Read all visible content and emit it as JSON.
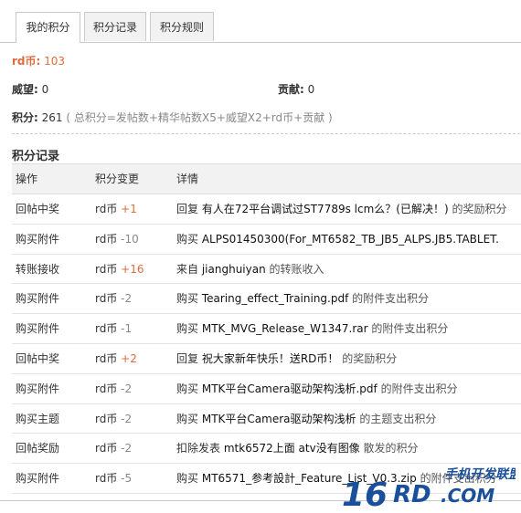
{
  "tabs": [
    "我的积分",
    "积分记录",
    "积分规则"
  ],
  "summary": {
    "rd_label": "rd币:",
    "rd_value": "103",
    "weiwang_label": "威望:",
    "weiwang_value": "0",
    "gongxian_label": "贡献:",
    "gongxian_value": "0",
    "total_label": "积分:",
    "total_value": "261",
    "total_formula": "( 总积分=发帖数+精华帖数X5+威望X2+rd币+贡献 )"
  },
  "section_title": "积分记录",
  "columns": [
    "操作",
    "积分变更",
    "详情"
  ],
  "rows": [
    {
      "op": "回帖中奖",
      "currency": "rd币",
      "amount": "+1",
      "positive": true,
      "verb": "回复",
      "link": "有人在72平台调试过ST7789s lcm么？(已解决！)",
      "tail": "的奖励积分"
    },
    {
      "op": "购买附件",
      "currency": "rd币",
      "amount": "-10",
      "positive": false,
      "verb": "购买",
      "link": "ALPS01450300(For_MT6582_TB_JB5_ALPS.JB5.TABLET.",
      "tail": ""
    },
    {
      "op": "转账接收",
      "currency": "rd币",
      "amount": "+16",
      "positive": true,
      "verb": "来自",
      "link": "jianghuiyan",
      "tail": "的转账收入"
    },
    {
      "op": "购买附件",
      "currency": "rd币",
      "amount": "-2",
      "positive": false,
      "verb": "购买",
      "link": "Tearing_effect_Training.pdf",
      "tail": "的附件支出积分"
    },
    {
      "op": "购买附件",
      "currency": "rd币",
      "amount": "-1",
      "positive": false,
      "verb": "购买",
      "link": "MTK_MVG_Release_W1347.rar",
      "tail": "的附件支出积分"
    },
    {
      "op": "回帖中奖",
      "currency": "rd币",
      "amount": "+2",
      "positive": true,
      "verb": "回复",
      "link": "祝大家新年快乐！送RD币！",
      "tail": "的奖励积分"
    },
    {
      "op": "购买附件",
      "currency": "rd币",
      "amount": "-2",
      "positive": false,
      "verb": "购买",
      "link": "MTK平台Camera驱动架构浅析.pdf",
      "tail": "的附件支出积分"
    },
    {
      "op": "购买主题",
      "currency": "rd币",
      "amount": "-2",
      "positive": false,
      "verb": "购买",
      "link": "MTK平台Camera驱动架构浅析",
      "tail": "的主题支出积分"
    },
    {
      "op": "回帖奖励",
      "currency": "rd币",
      "amount": "-2",
      "positive": false,
      "verb": "扣除发表",
      "link": "mtk6572上面 atv没有图像",
      "tail": "散发的积分"
    },
    {
      "op": "购买附件",
      "currency": "rd币",
      "amount": "-5",
      "positive": false,
      "verb": "购买",
      "link": "MT6571_参考設計_Feature_List_V0.3.zip",
      "tail": "的附件支出积分"
    }
  ],
  "watermark": {
    "big": "16",
    "rd": "RD",
    "com": ".COM",
    "cn": "手机开发联盟"
  },
  "colors": {
    "accent": "#e06b3c",
    "watermark_blue": "#1a4f9c"
  }
}
